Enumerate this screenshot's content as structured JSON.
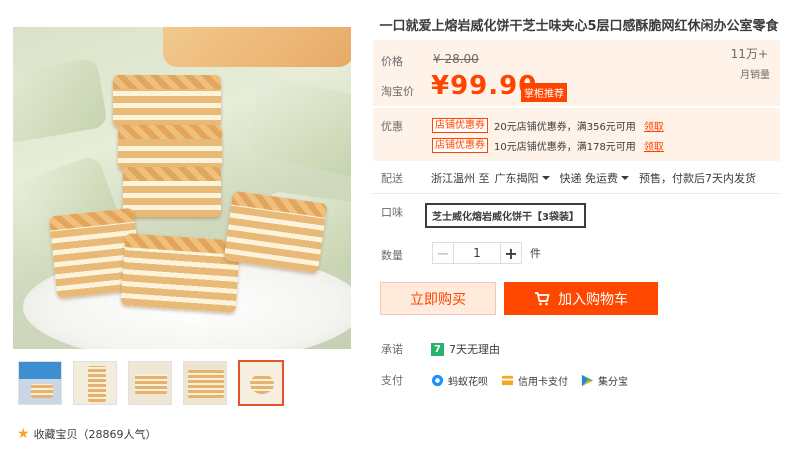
{
  "product": {
    "title": "一口就爱上熔岩威化饼干芝士味夹心5层口感酥脆网红休闲办公室零食"
  },
  "price": {
    "orig_label": "价格",
    "orig_value": "¥ 28.00",
    "promo_label": "淘宝价",
    "promo_value": "¥99.90",
    "promo_badge": "掌柜推荐",
    "monthly_sales": "11万+",
    "monthly_sales_label": "月销量"
  },
  "coupons": {
    "label": "优惠",
    "items": [
      {
        "tag": "店铺优惠券",
        "text": "20元店铺优惠券，满356元可用",
        "action": "领取"
      },
      {
        "tag": "店铺优惠券",
        "text": "10元店铺优惠券，满178元可用",
        "action": "领取"
      }
    ]
  },
  "delivery": {
    "label": "配送",
    "origin": "浙江温州 至",
    "destination": "广东揭阳",
    "shipping": "快递 免运费",
    "note": "预售，付款后7天内发货"
  },
  "flavor": {
    "label": "口味",
    "selected": "芝士威化熔岩威化饼干【3袋装】"
  },
  "quantity": {
    "label": "数量",
    "value": "1",
    "minus": "−",
    "plus": "+",
    "unit": "件"
  },
  "actions": {
    "buy_now": "立即购买",
    "add_to_cart": "加入购物车"
  },
  "promise": {
    "label": "承诺",
    "badge": "7",
    "text": "7天无理由"
  },
  "payment": {
    "label": "支付",
    "methods": [
      "蚂蚁花呗",
      "信用卡支付",
      "集分宝"
    ]
  },
  "favorite": {
    "text": "收藏宝贝（28869人气）"
  },
  "colors": {
    "accent": "#ff4400",
    "price_bg": "#fff2e8",
    "promise_green": "#27b36b"
  }
}
